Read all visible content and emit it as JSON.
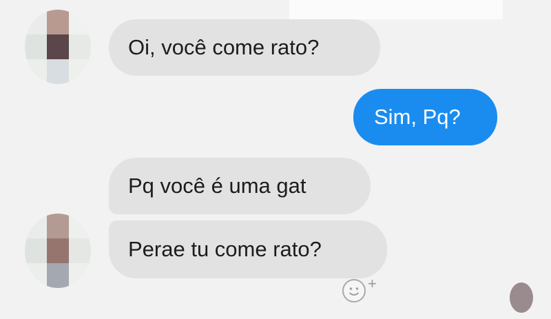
{
  "messages": [
    {
      "direction": "incoming",
      "text": "Oi, você come rato?"
    },
    {
      "direction": "outgoing",
      "text": "Sim, Pq?"
    },
    {
      "direction": "incoming",
      "text": "Pq você é uma gat"
    },
    {
      "direction": "incoming",
      "text": "Perae tu come rato?"
    }
  ],
  "colors": {
    "background": "#f2f2f2",
    "incoming_bubble": "#e2e2e2",
    "outgoing_bubble": "#1a8cf0"
  },
  "icons": {
    "react": "emoji-add-icon",
    "plus": "+"
  }
}
